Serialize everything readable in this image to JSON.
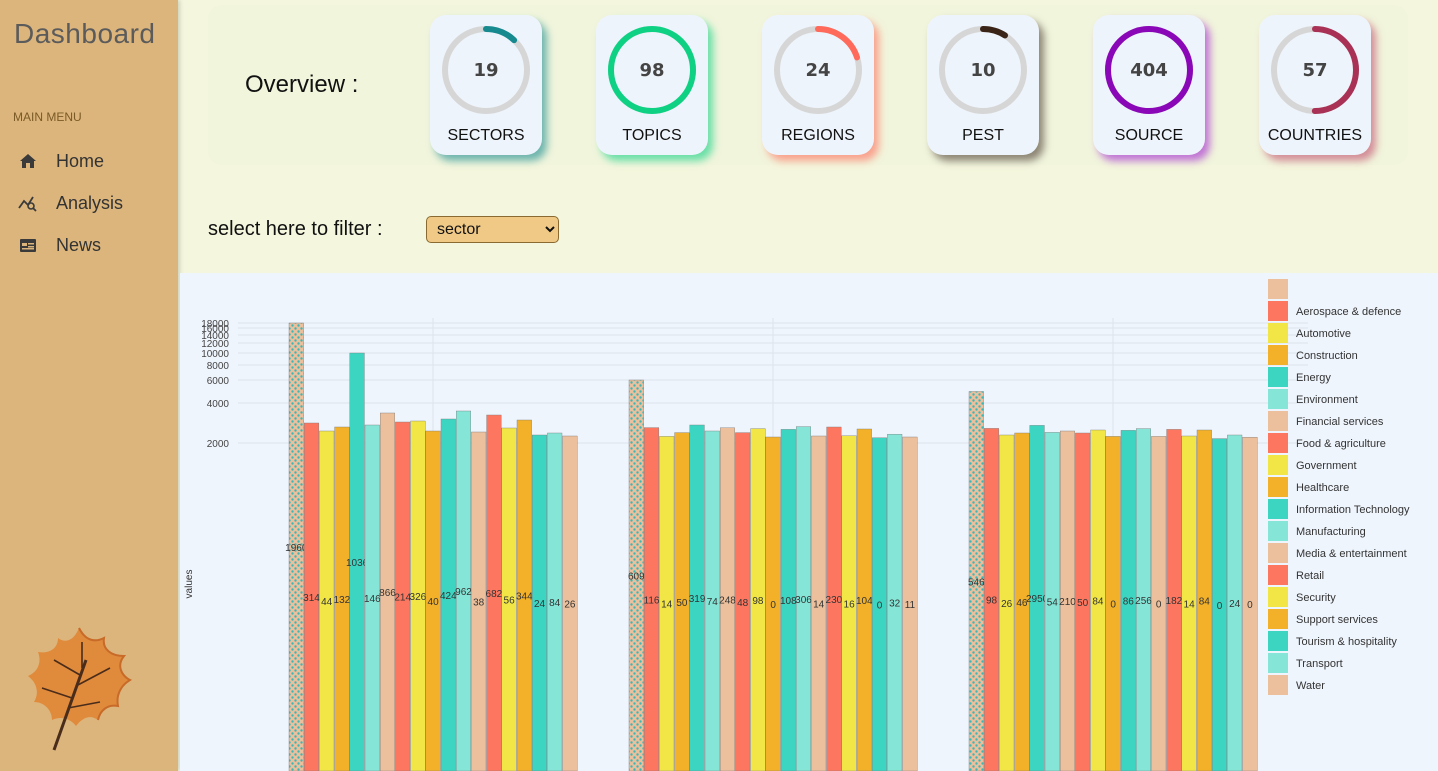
{
  "sidebar": {
    "logo": "Dashboard",
    "menu_heading": "MAIN MENU",
    "items": [
      {
        "label": "Home",
        "icon": "home-icon"
      },
      {
        "label": "Analysis",
        "icon": "analysis-icon"
      },
      {
        "label": "News",
        "icon": "news-icon"
      }
    ]
  },
  "overview": {
    "title": "Overview :",
    "cards": [
      {
        "label": "SECTORS",
        "value": "19",
        "progress": 0.12,
        "color": "#168a8f",
        "glow": "#168a8f"
      },
      {
        "label": "TOPICS",
        "value": "98",
        "progress": 1.0,
        "color": "#0fd184",
        "glow": "#0fd184"
      },
      {
        "label": "REGIONS",
        "value": "24",
        "progress": 0.2,
        "color": "#ff6a5a",
        "glow": "#ff6a5a"
      },
      {
        "label": "PEST",
        "value": "10",
        "progress": 0.09,
        "color": "#3a2418",
        "glow": "#4a3a30"
      },
      {
        "label": "SOURCE",
        "value": "404",
        "progress": 1.0,
        "color": "#8a07b7",
        "glow": "#a020d0"
      },
      {
        "label": "COUNTRIES",
        "value": "57",
        "progress": 0.5,
        "color": "#a83155",
        "glow": "#c04a6a"
      }
    ]
  },
  "filter": {
    "label": "select here to filter :",
    "selected": "sector"
  },
  "chart_data": {
    "type": "bar",
    "ylabel": "values",
    "ytick_labels": [
      "2000",
      "4000",
      "6000",
      "8000",
      "10000",
      "12000",
      "14000",
      "16000",
      "18000"
    ],
    "series_names": [
      "",
      "Aerospace & defence",
      "Automotive",
      "Construction",
      "Energy",
      "Environment",
      "Financial services",
      "Food & agriculture",
      "Government",
      "Healthcare",
      "Information Technology",
      "Manufacturing",
      "Media & entertainment",
      "Retail",
      "Security",
      "Support services",
      "Tourism & hospitality",
      "Transport",
      "Water"
    ],
    "series_colors": [
      "#ecc09c",
      "#fd7760",
      "#f2e647",
      "#f2b128",
      "#3cd5c2",
      "#85e6d8",
      "#ecc09c",
      "#fd7760",
      "#f2e647",
      "#f2b128",
      "#3cd5c2",
      "#85e6d8",
      "#ecc09c",
      "#fd7760",
      "#f2e647",
      "#f2b128",
      "#3cd5c2",
      "#85e6d8",
      "#ecc09c"
    ],
    "groups": [
      {
        "values": [
          18000,
          3000,
          2600,
          2800,
          10000,
          2900,
          3500,
          3050,
          3100,
          2600,
          3200,
          3600,
          2550,
          3400,
          2750,
          3150,
          2400,
          2500,
          2350
        ],
        "labels": [
          "1960",
          "314",
          "44",
          "132",
          "1036",
          "146",
          "866",
          "214",
          "326",
          "40",
          "424",
          "962",
          "38",
          "682",
          "56",
          "344",
          "24",
          "84",
          "26"
        ]
      },
      {
        "values": [
          6000,
          2770,
          2330,
          2520,
          2900,
          2600,
          2760,
          2520,
          2720,
          2300,
          2680,
          2820,
          2350,
          2800,
          2360,
          2700,
          2260,
          2440,
          2300
        ],
        "labels": [
          "609",
          "116",
          "14",
          "50",
          "319",
          "74",
          "248",
          "48",
          "98",
          "0",
          "108",
          "306",
          "14",
          "230",
          "16",
          "104",
          "0",
          "32",
          "11"
        ]
      },
      {
        "values": [
          5000,
          2730,
          2400,
          2500,
          2880,
          2530,
          2600,
          2500,
          2650,
          2330,
          2630,
          2720,
          2330,
          2680,
          2350,
          2650,
          2220,
          2400,
          2290
        ],
        "labels": [
          "546",
          "98",
          "26",
          "46",
          "2950",
          "54",
          "210",
          "50",
          "84",
          "0",
          "86",
          "256",
          "0",
          "182",
          "14",
          "84",
          "0",
          "24",
          "0"
        ]
      }
    ]
  }
}
